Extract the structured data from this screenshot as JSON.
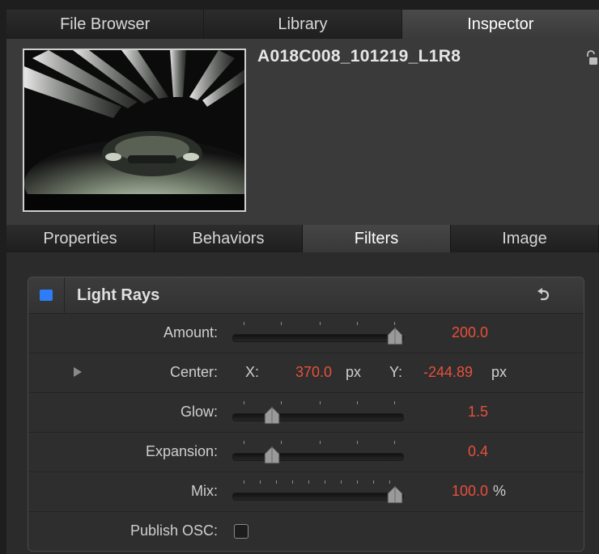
{
  "top_tabs": [
    {
      "label": "File Browser",
      "active": false
    },
    {
      "label": "Library",
      "active": false
    },
    {
      "label": "Inspector",
      "active": true
    }
  ],
  "clip": {
    "name": "A018C008_101219_L1R8"
  },
  "sub_tabs": [
    {
      "label": "Properties",
      "active": false
    },
    {
      "label": "Behaviors",
      "active": false
    },
    {
      "label": "Filters",
      "active": true
    },
    {
      "label": "Image",
      "active": false
    }
  ],
  "filter": {
    "title": "Light Rays",
    "enabled": true,
    "enable_color": "#2f7df6",
    "params": {
      "amount": {
        "label": "Amount:",
        "value": "200.0",
        "slider_fraction": 0.95
      },
      "center": {
        "label": "Center:",
        "x_label": "X:",
        "x_value": "370.0",
        "x_unit": "px",
        "y_label": "Y:",
        "y_value": "-244.89",
        "y_unit": "px"
      },
      "glow": {
        "label": "Glow:",
        "value": "1.5",
        "slider_fraction": 0.23
      },
      "expansion": {
        "label": "Expansion:",
        "value": "0.4",
        "slider_fraction": 0.23
      },
      "mix": {
        "label": "Mix:",
        "value": "100.0",
        "unit": "%",
        "slider_fraction": 0.95
      },
      "publish_osc": {
        "label": "Publish OSC:",
        "checked": false
      }
    }
  },
  "value_color": "#e8503a"
}
